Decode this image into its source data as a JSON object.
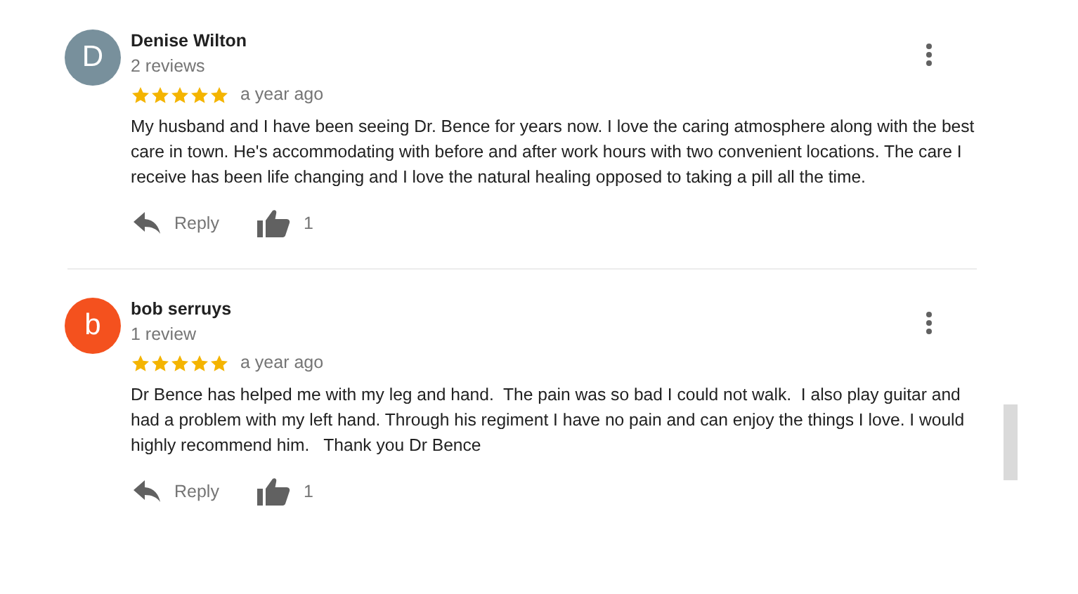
{
  "reviews": [
    {
      "initial": "D",
      "color": "#78909c",
      "name": "Denise Wilton",
      "review_count": "2 reviews",
      "stars": 5,
      "time": "a year ago",
      "text": "My husband and I have been seeing Dr. Bence for years now. I love the caring atmosphere along with the best care in town. He's accommodating with before and after work hours with two convenient locations. The care I receive has been life changing and I love the natural healing opposed to taking a pill all the time.",
      "reply": "Reply",
      "likes": "1"
    },
    {
      "initial": "b",
      "color": "#f4511e",
      "name": "bob serruys",
      "review_count": "1 review",
      "stars": 5,
      "time": "a year ago",
      "text": "Dr Bence has helped me with my leg and hand.  The pain was so bad I could not walk.  I also play guitar and had a problem with my left hand. Through his regiment I have no pain and can enjoy the things I love. I would highly recommend him.   Thank you Dr Bence",
      "reply": "Reply",
      "likes": "1"
    }
  ]
}
